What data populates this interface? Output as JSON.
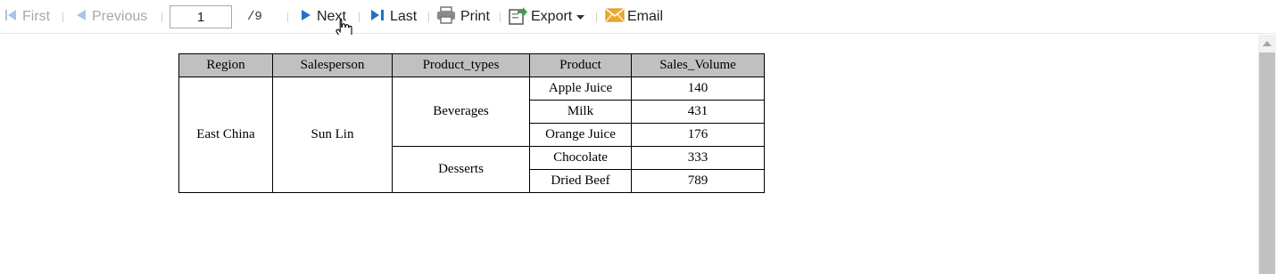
{
  "toolbar": {
    "first_label": "First",
    "previous_label": "Previous",
    "page_value": "1",
    "page_total": "/9",
    "next_label": "Next",
    "last_label": "Last",
    "print_label": "Print",
    "export_label": "Export",
    "email_label": "Email"
  },
  "report": {
    "headers": [
      "Region",
      "Salesperson",
      "Product_types",
      "Product",
      "Sales_Volume"
    ],
    "region": "East China",
    "salesperson": "Sun Lin",
    "groups": [
      {
        "type": "Beverages",
        "rows": [
          {
            "product": "Apple Juice",
            "volume": "140"
          },
          {
            "product": "Milk",
            "volume": "431"
          },
          {
            "product": "Orange Juice",
            "volume": "176"
          }
        ]
      },
      {
        "type": "Desserts",
        "rows": [
          {
            "product": "Chocolate",
            "volume": "333"
          },
          {
            "product": "Dried Beef",
            "volume": "789"
          }
        ]
      }
    ]
  },
  "colors": {
    "accent_blue": "#1e73c8",
    "disabled": "#a8a8a8",
    "header_fill": "#c0c0c0",
    "email_orange": "#f0a830",
    "export_green": "#3ca048"
  }
}
